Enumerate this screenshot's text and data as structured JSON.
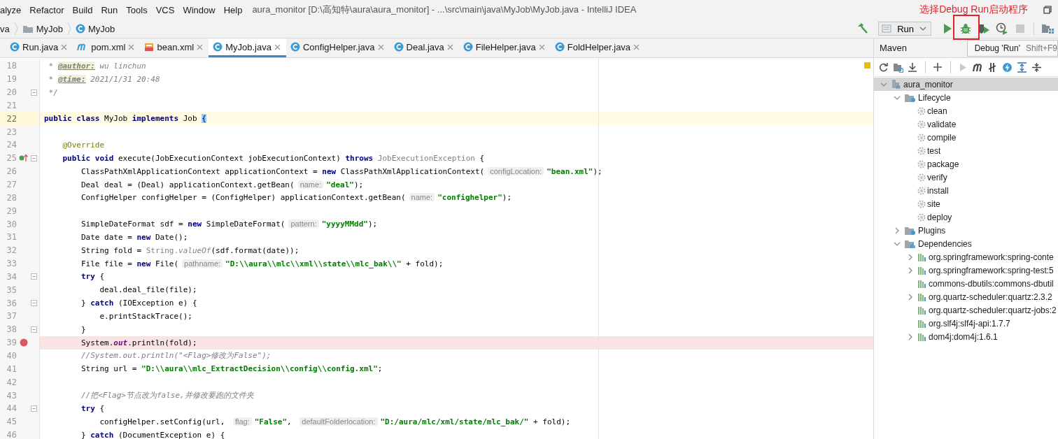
{
  "menu": [
    "alyze",
    "Refactor",
    "Build",
    "Run",
    "Tools",
    "VCS",
    "Window",
    "Help"
  ],
  "window": {
    "title": "aura_monitor [D:\\高知特\\aura\\aura_monitor] - ...\\src\\main\\java\\MyJob\\MyJob.java - IntelliJ IDEA"
  },
  "annotation": "选择Debug Run启动程序",
  "breadcrumbs": [
    {
      "kind": "text",
      "text": "va"
    },
    {
      "kind": "folder",
      "text": "MyJob"
    },
    {
      "kind": "class",
      "text": "MyJob"
    }
  ],
  "run_config": "Run",
  "tooltip": {
    "action": "Debug 'Run'",
    "shortcut": "Shift+F9"
  },
  "tabs": [
    {
      "kind": "class",
      "label": "Run.java",
      "selected": false
    },
    {
      "kind": "maven",
      "label": "pom.xml",
      "selected": false
    },
    {
      "kind": "xml",
      "label": "bean.xml",
      "selected": false
    },
    {
      "kind": "class",
      "label": "MyJob.java",
      "selected": true
    },
    {
      "kind": "class",
      "label": "ConfigHelper.java",
      "selected": false
    },
    {
      "kind": "class",
      "label": "Deal.java",
      "selected": false
    },
    {
      "kind": "class",
      "label": "FileHelper.java",
      "selected": false
    },
    {
      "kind": "class",
      "label": "FoldHelper.java",
      "selected": false
    }
  ],
  "editor": {
    "lines": [
      {
        "number": "18",
        "current": false,
        "breakpoint": false,
        "fold": false,
        "override": false,
        "segments": [
          {
            "kind": "doc",
            "text": " * "
          },
          {
            "kind": "doctag",
            "text": "@author:"
          },
          {
            "kind": "doc",
            "text": " wu linchun"
          }
        ]
      },
      {
        "number": "19",
        "current": false,
        "breakpoint": false,
        "fold": false,
        "override": false,
        "segments": [
          {
            "kind": "doc",
            "text": " * "
          },
          {
            "kind": "doctag",
            "text": "@time:"
          },
          {
            "kind": "doc",
            "text": " 2021/1/31 20:48"
          }
        ]
      },
      {
        "number": "20",
        "current": false,
        "breakpoint": false,
        "fold": true,
        "override": false,
        "segments": [
          {
            "kind": "doc",
            "text": " */"
          }
        ]
      },
      {
        "number": "21",
        "current": false,
        "breakpoint": false,
        "fold": false,
        "override": false
      },
      {
        "number": "22",
        "current": true,
        "breakpoint": false,
        "fold": false,
        "override": false,
        "segments": [
          {
            "kind": "kw",
            "text": "public class"
          },
          {
            "kind": "plain",
            "text": " MyJob "
          },
          {
            "kind": "kw",
            "text": "implements"
          },
          {
            "kind": "plain",
            "text": " Job "
          },
          {
            "kind": "brace",
            "text": "{"
          }
        ]
      },
      {
        "number": "23",
        "current": false,
        "breakpoint": false,
        "fold": false,
        "override": false
      },
      {
        "number": "24",
        "current": false,
        "breakpoint": false,
        "fold": false,
        "override": false,
        "segments": [
          {
            "kind": "annot",
            "text": "    @Override"
          }
        ]
      },
      {
        "number": "25",
        "current": false,
        "breakpoint": false,
        "fold": true,
        "override": true,
        "segments": [
          {
            "kind": "kw",
            "text": "    public void"
          },
          {
            "kind": "plain",
            "text": " execute(JobExecutionContext jobExecutionContext) "
          },
          {
            "kind": "kw",
            "text": "throws "
          },
          {
            "kind": "grey",
            "text": "JobExecutionException"
          },
          {
            "kind": "plain",
            "text": " {"
          }
        ]
      },
      {
        "number": "26",
        "current": false,
        "breakpoint": false,
        "fold": false,
        "override": false,
        "segments": [
          {
            "kind": "plain",
            "text": "        ClassPathXmlApplicationContext applicationContext = "
          },
          {
            "kind": "kw",
            "text": "new"
          },
          {
            "kind": "plain",
            "text": " ClassPathXmlApplicationContext("
          },
          {
            "kind": "hint",
            "text": "configLocation:"
          },
          {
            "kind": "str",
            "text": "\"bean.xml\""
          },
          {
            "kind": "plain",
            "text": ");"
          }
        ]
      },
      {
        "number": "27",
        "current": false,
        "breakpoint": false,
        "fold": false,
        "override": false,
        "segments": [
          {
            "kind": "plain",
            "text": "        Deal deal = (Deal) applicationContext.getBean("
          },
          {
            "kind": "hint",
            "text": "name:"
          },
          {
            "kind": "str",
            "text": "\"deal\""
          },
          {
            "kind": "plain",
            "text": ");"
          }
        ]
      },
      {
        "number": "28",
        "current": false,
        "breakpoint": false,
        "fold": false,
        "override": false,
        "segments": [
          {
            "kind": "plain",
            "text": "        ConfigHelper configHelper = (ConfigHelper) applicationContext.getBean("
          },
          {
            "kind": "hint",
            "text": "name:"
          },
          {
            "kind": "str",
            "text": "\"confighelper\""
          },
          {
            "kind": "plain",
            "text": ");"
          }
        ]
      },
      {
        "number": "29",
        "current": false,
        "breakpoint": false,
        "fold": false,
        "override": false
      },
      {
        "number": "30",
        "current": false,
        "breakpoint": false,
        "fold": false,
        "override": false,
        "segments": [
          {
            "kind": "plain",
            "text": "        SimpleDateFormat sdf = "
          },
          {
            "kind": "kw",
            "text": "new"
          },
          {
            "kind": "plain",
            "text": " SimpleDateFormat("
          },
          {
            "kind": "hint",
            "text": "pattern:"
          },
          {
            "kind": "str",
            "text": "\"yyyyMMdd\""
          },
          {
            "kind": "plain",
            "text": ");"
          }
        ]
      },
      {
        "number": "31",
        "current": false,
        "breakpoint": false,
        "fold": false,
        "override": false,
        "segments": [
          {
            "kind": "plain",
            "text": "        Date date = "
          },
          {
            "kind": "kw",
            "text": "new"
          },
          {
            "kind": "plain",
            "text": " Date();"
          }
        ]
      },
      {
        "number": "32",
        "current": false,
        "breakpoint": false,
        "fold": false,
        "override": false,
        "segments": [
          {
            "kind": "plain",
            "text": "        String fold = "
          },
          {
            "kind": "grey",
            "text": "String."
          },
          {
            "kind": "grey-italic",
            "text": "valueOf"
          },
          {
            "kind": "plain",
            "text": "(sdf.format(date));"
          }
        ]
      },
      {
        "number": "33",
        "current": false,
        "breakpoint": false,
        "fold": false,
        "override": false,
        "segments": [
          {
            "kind": "plain",
            "text": "        File file = "
          },
          {
            "kind": "kw",
            "text": "new"
          },
          {
            "kind": "plain",
            "text": " File("
          },
          {
            "kind": "hint",
            "text": "pathname:"
          },
          {
            "kind": "str",
            "text": "\"D:\\\\aura\\\\mlc\\\\xml\\\\state\\\\mlc_bak\\\\\""
          },
          {
            "kind": "plain",
            "text": " + fold);"
          }
        ]
      },
      {
        "number": "34",
        "current": false,
        "breakpoint": false,
        "fold": true,
        "override": false,
        "segments": [
          {
            "kind": "kw",
            "text": "        try"
          },
          {
            "kind": "plain",
            "text": " {"
          }
        ]
      },
      {
        "number": "35",
        "current": false,
        "breakpoint": false,
        "fold": false,
        "override": false,
        "segments": [
          {
            "kind": "plain",
            "text": "            deal.deal_file(file);"
          }
        ]
      },
      {
        "number": "36",
        "current": false,
        "breakpoint": false,
        "fold": true,
        "override": false,
        "segments": [
          {
            "kind": "plain",
            "text": "        } "
          },
          {
            "kind": "kw",
            "text": "catch"
          },
          {
            "kind": "plain",
            "text": " (IOException e) {"
          }
        ]
      },
      {
        "number": "37",
        "current": false,
        "breakpoint": false,
        "fold": false,
        "override": false,
        "segments": [
          {
            "kind": "plain",
            "text": "            e.printStackTrace();"
          }
        ]
      },
      {
        "number": "38",
        "current": false,
        "breakpoint": false,
        "fold": true,
        "override": false,
        "segments": [
          {
            "kind": "plain",
            "text": "        }"
          }
        ]
      },
      {
        "number": "39",
        "current": false,
        "breakpoint": true,
        "fold": false,
        "override": false,
        "segments": [
          {
            "kind": "plain",
            "text": "        System."
          },
          {
            "kind": "static",
            "text": "out"
          },
          {
            "kind": "plain",
            "text": ".println(fold);"
          }
        ]
      },
      {
        "number": "40",
        "current": false,
        "breakpoint": false,
        "fold": false,
        "override": false,
        "segments": [
          {
            "kind": "comment",
            "text": "        //System.out.println(\"<Flag>修改为False\");"
          }
        ]
      },
      {
        "number": "41",
        "current": false,
        "breakpoint": false,
        "fold": false,
        "override": false,
        "segments": [
          {
            "kind": "plain",
            "text": "        String url = "
          },
          {
            "kind": "str",
            "text": "\"D:\\\\aura\\\\mlc_ExtractDecision\\\\config\\\\config.xml\""
          },
          {
            "kind": "plain",
            "text": ";"
          }
        ]
      },
      {
        "number": "42",
        "current": false,
        "breakpoint": false,
        "fold": false,
        "override": false
      },
      {
        "number": "43",
        "current": false,
        "breakpoint": false,
        "fold": false,
        "override": false,
        "segments": [
          {
            "kind": "comment",
            "text": "        //把<Flag>节点改为false,并修改要跑的文件夹"
          }
        ]
      },
      {
        "number": "44",
        "current": false,
        "breakpoint": false,
        "fold": true,
        "override": false,
        "segments": [
          {
            "kind": "kw",
            "text": "        try"
          },
          {
            "kind": "plain",
            "text": " {"
          }
        ]
      },
      {
        "number": "45",
        "current": false,
        "breakpoint": false,
        "fold": false,
        "override": false,
        "segments": [
          {
            "kind": "plain",
            "text": "            configHelper.setConfig(url, "
          },
          {
            "kind": "hint",
            "text": "flag:"
          },
          {
            "kind": "str",
            "text": "\"False\""
          },
          {
            "kind": "plain",
            "text": ", "
          },
          {
            "kind": "hint",
            "text": "defaultFolderlocation:"
          },
          {
            "kind": "str",
            "text": "\"D:/aura/mlc/xml/state/mlc_bak/\""
          },
          {
            "kind": "plain",
            "text": " + fold);"
          }
        ]
      },
      {
        "number": "46",
        "current": false,
        "breakpoint": false,
        "fold": false,
        "override": false,
        "segments": [
          {
            "kind": "plain",
            "text": "        } "
          },
          {
            "kind": "kw",
            "text": "catch"
          },
          {
            "kind": "plain",
            "text": " (DocumentException e) {"
          }
        ]
      }
    ]
  },
  "maven": {
    "title": "Maven",
    "tree": [
      {
        "kind": "project",
        "label": "aura_monitor",
        "expanded": true,
        "selected": true,
        "children": [
          {
            "kind": "lifecycle",
            "label": "Lifecycle",
            "expanded": true,
            "selected": false,
            "children": [
              {
                "kind": "goal",
                "label": "clean",
                "selected": false
              },
              {
                "kind": "goal",
                "label": "validate",
                "selected": false
              },
              {
                "kind": "goal",
                "label": "compile",
                "selected": false
              },
              {
                "kind": "goal",
                "label": "test",
                "selected": false
              },
              {
                "kind": "goal",
                "label": "package",
                "selected": false
              },
              {
                "kind": "goal",
                "label": "verify",
                "selected": false
              },
              {
                "kind": "goal",
                "label": "install",
                "selected": false
              },
              {
                "kind": "goal",
                "label": "site",
                "selected": false
              },
              {
                "kind": "goal",
                "label": "deploy",
                "selected": false
              }
            ]
          },
          {
            "kind": "lifecycle",
            "label": "Plugins",
            "expanded": false,
            "selected": false
          },
          {
            "kind": "dependencies",
            "label": "Dependencies",
            "expanded": true,
            "selected": false,
            "children": [
              {
                "kind": "dependency",
                "label": "org.springframework:spring-conte",
                "expanded": false,
                "selected": false
              },
              {
                "kind": "dependency",
                "label": "org.springframework:spring-test:5",
                "expanded": false,
                "selected": false
              },
              {
                "kind": "dependency",
                "label": "commons-dbutils:commons-dbutil",
                "selected": false
              },
              {
                "kind": "dependency",
                "label": "org.quartz-scheduler:quartz:2.3.2",
                "expanded": false,
                "selected": false
              },
              {
                "kind": "dependency",
                "label": "org.quartz-scheduler:quartz-jobs:2",
                "selected": false
              },
              {
                "kind": "dependency",
                "label": "org.slf4j:slf4j-api:1.7.7",
                "selected": false
              },
              {
                "kind": "dependency",
                "label": "dom4j:dom4j:1.6.1",
                "expanded": false,
                "selected": false
              }
            ]
          }
        ]
      }
    ]
  }
}
